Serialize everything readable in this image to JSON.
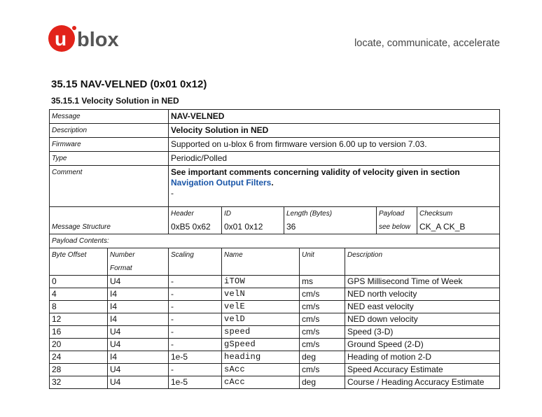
{
  "header": {
    "logo_text": "ublox",
    "tagline": "locate, communicate, accelerate",
    "colors": {
      "logo_red": "#e2231a",
      "logo_gray": "#555555",
      "link": "#1a56a8"
    }
  },
  "section": {
    "title": "35.15 NAV-VELNED (0x01 0x12)",
    "subtitle": "35.15.1 Velocity Solution in NED"
  },
  "info": {
    "message_label": "Message",
    "message_value": "NAV-VELNED",
    "description_label": "Description",
    "description_value": "Velocity Solution in NED",
    "firmware_label": "Firmware",
    "firmware_value": "Supported on u-blox 6 from firmware version 6.00 up to version 7.03.",
    "type_label": "Type",
    "type_value": "Periodic/Polled",
    "comment_label": "Comment",
    "comment_text": "See important comments concerning validity of velocity given in section",
    "comment_link": "Navigation Output Filters",
    "comment_period": ".",
    "comment_dash": "-"
  },
  "structure": {
    "label": "Message Structure",
    "header_label": "Header",
    "header_value": "0xB5 0x62",
    "id_label": "ID",
    "id_value": "0x01 0x12",
    "length_label": "Length (Bytes)",
    "length_value": "36",
    "payload_label": "Payload",
    "payload_value": "see below",
    "checksum_label": "Checksum",
    "checksum_value": "CK_A CK_B"
  },
  "payload": {
    "contents_label": "Payload Contents:",
    "columns": {
      "offset": "Byte Offset",
      "format_1": "Number",
      "format_2": "Format",
      "scaling": "Scaling",
      "name": "Name",
      "unit": "Unit",
      "description": "Description"
    },
    "rows": [
      {
        "offset": "0",
        "format": "U4",
        "scaling": "-",
        "name": "iTOW",
        "unit": "ms",
        "description": "GPS Millisecond Time of Week"
      },
      {
        "offset": "4",
        "format": "I4",
        "scaling": "-",
        "name": "velN",
        "unit": "cm/s",
        "description": "NED north velocity"
      },
      {
        "offset": "8",
        "format": "I4",
        "scaling": "-",
        "name": "velE",
        "unit": "cm/s",
        "description": "NED east velocity"
      },
      {
        "offset": "12",
        "format": "I4",
        "scaling": "-",
        "name": "velD",
        "unit": "cm/s",
        "description": "NED down velocity"
      },
      {
        "offset": "16",
        "format": "U4",
        "scaling": "-",
        "name": "speed",
        "unit": "cm/s",
        "description": "Speed (3-D)"
      },
      {
        "offset": "20",
        "format": "U4",
        "scaling": "-",
        "name": "gSpeed",
        "unit": "cm/s",
        "description": "Ground Speed (2-D)"
      },
      {
        "offset": "24",
        "format": "I4",
        "scaling": "1e-5",
        "name": "heading",
        "unit": "deg",
        "description": "Heading of motion 2-D"
      },
      {
        "offset": "28",
        "format": "U4",
        "scaling": "-",
        "name": "sAcc",
        "unit": "cm/s",
        "description": "Speed Accuracy Estimate"
      },
      {
        "offset": "32",
        "format": "U4",
        "scaling": "1e-5",
        "name": "cAcc",
        "unit": "deg",
        "description": "Course / Heading Accuracy Estimate"
      }
    ]
  }
}
